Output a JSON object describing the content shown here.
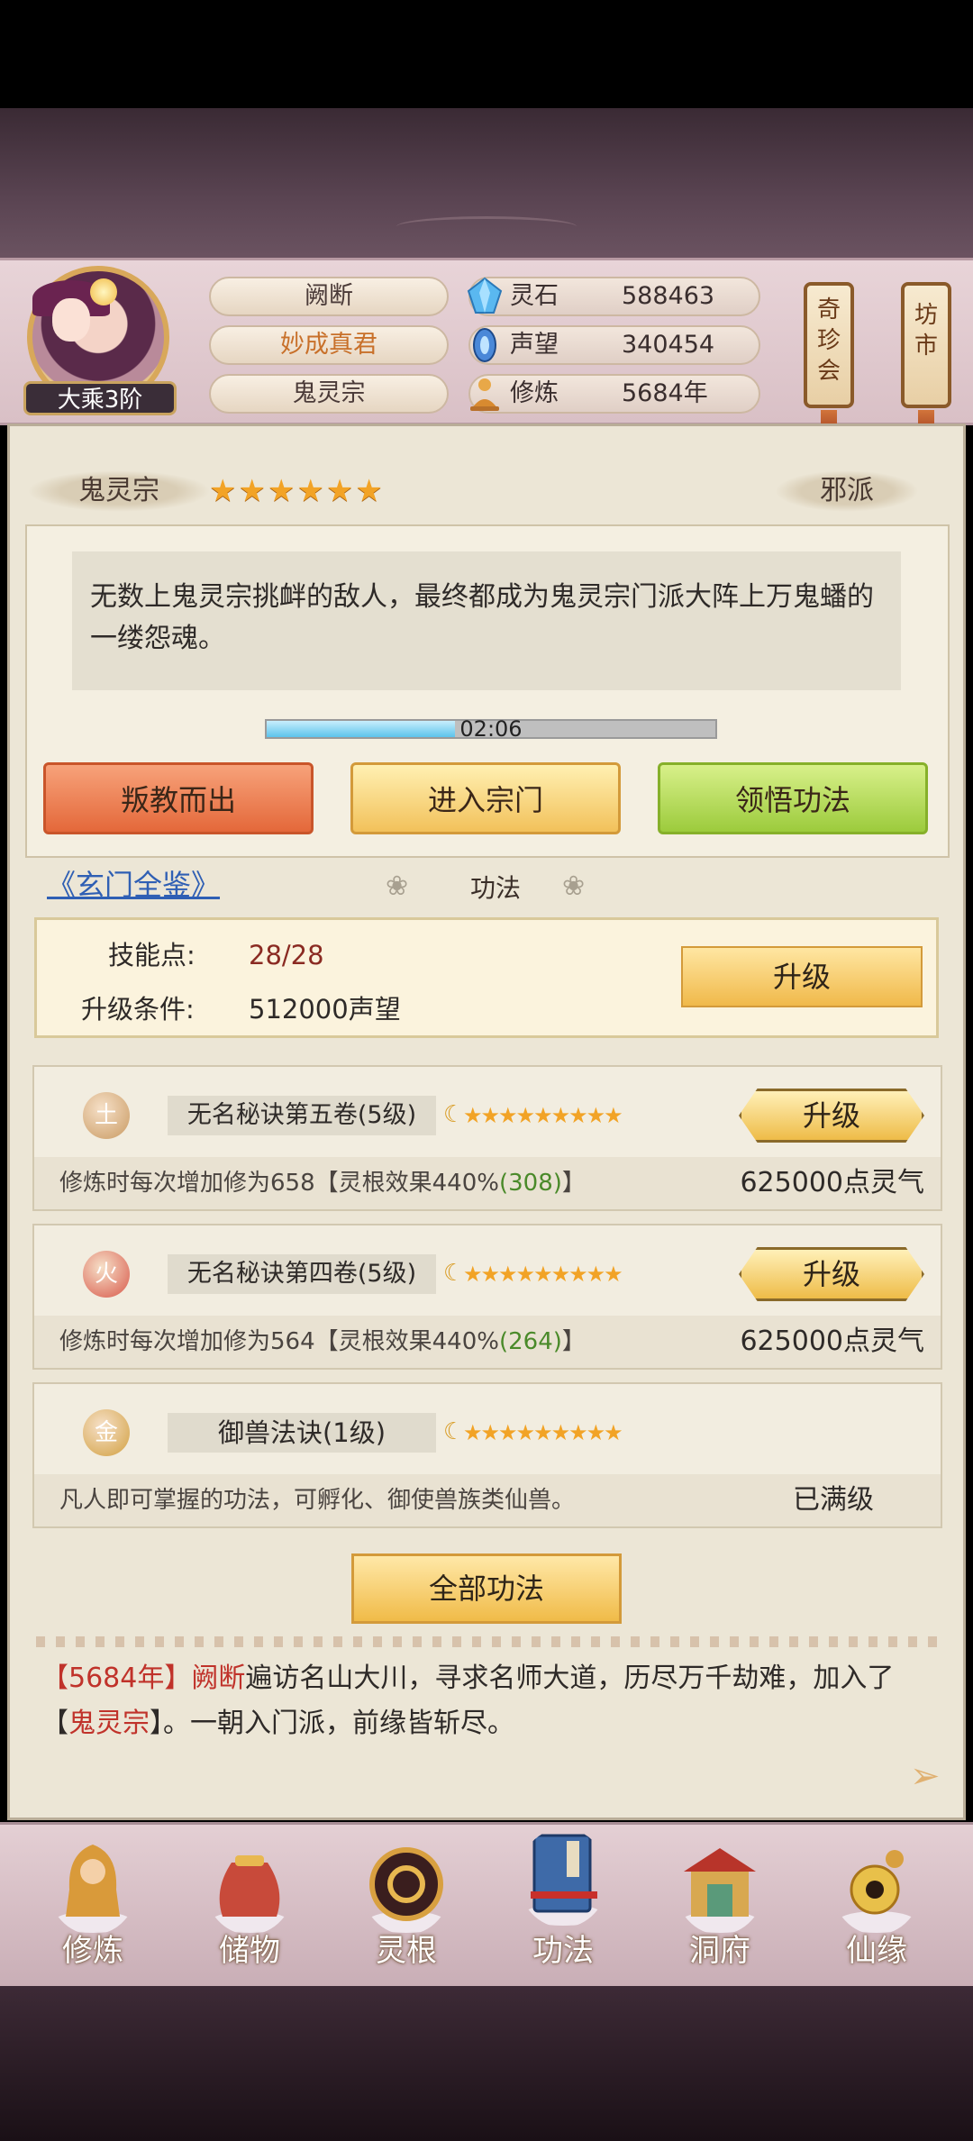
{
  "header": {
    "rank": "大乘3阶",
    "name": "阙断",
    "title": "妙成真君",
    "sect": "鬼灵宗",
    "resources": [
      {
        "label": "灵石",
        "value": "588463",
        "icon": "spirit-stone-icon"
      },
      {
        "label": "声望",
        "value": "340454",
        "icon": "prestige-icon"
      },
      {
        "label": "修炼",
        "value": "5684年",
        "icon": "cultivation-icon"
      }
    ],
    "lanterns": [
      {
        "label": "奇珍会"
      },
      {
        "label": "坊市"
      }
    ]
  },
  "sect_info": {
    "name": "鬼灵宗",
    "stars": "★★★★★★",
    "faction": "邪派",
    "description": "无数上鬼灵宗挑衅的敌人，最终都成为鬼灵宗门派大阵上万鬼蟠的一缕怨魂。",
    "timer": "02:06",
    "timer_progress": 0.42,
    "buttons": {
      "betray": "叛教而出",
      "enter": "进入宗门",
      "comprehend": "领悟功法"
    }
  },
  "skills_section": {
    "link": "《玄门全鉴》",
    "title": "功法",
    "skill_points_label": "技能点:",
    "skill_points_value": "28/28",
    "condition_label": "升级条件:",
    "condition_value": "512000声望",
    "upgrade": "升级"
  },
  "skills": [
    {
      "element": "土",
      "element_color": "#c99a62",
      "name": "无名秘诀第五卷(5级)",
      "stars": "★★★★★★★★★",
      "button": "升级",
      "desc_prefix": "修炼时每次增加修为658【灵根效果440%",
      "desc_highlight": "(308)",
      "desc_suffix": "】",
      "cost": "625000点灵气"
    },
    {
      "element": "火",
      "element_color": "#d8584a",
      "name": "无名秘诀第四卷(5级)",
      "stars": "★★★★★★★★★",
      "button": "升级",
      "desc_prefix": "修炼时每次增加修为564【灵根效果440%",
      "desc_highlight": "(264)",
      "desc_suffix": "】",
      "cost": "625000点灵气"
    },
    {
      "element": "金",
      "element_color": "#d2a040",
      "name": "御兽法诀(1级)",
      "stars": "★★★★★★★★★",
      "desc_prefix": "凡人即可掌握的功法，可孵化、御使兽族类仙兽。",
      "cost": "已满级"
    }
  ],
  "all_skills_button": "全部功法",
  "log": {
    "year": "5684年",
    "name": "阙断",
    "text1": "遍访名山大川，寻求名师大道，历尽万千劫难，加入了",
    "sect": "鬼灵宗",
    "text2": "。一朝入门派，前缘皆斩尽。"
  },
  "nav": [
    {
      "label": "修炼",
      "icon": "cultivate-icon"
    },
    {
      "label": "储物",
      "icon": "storage-bag-icon"
    },
    {
      "label": "灵根",
      "icon": "spirit-root-icon"
    },
    {
      "label": "功法",
      "icon": "skill-book-icon"
    },
    {
      "label": "洞府",
      "icon": "cave-dwelling-icon"
    },
    {
      "label": "仙缘",
      "icon": "fortune-icon"
    }
  ]
}
